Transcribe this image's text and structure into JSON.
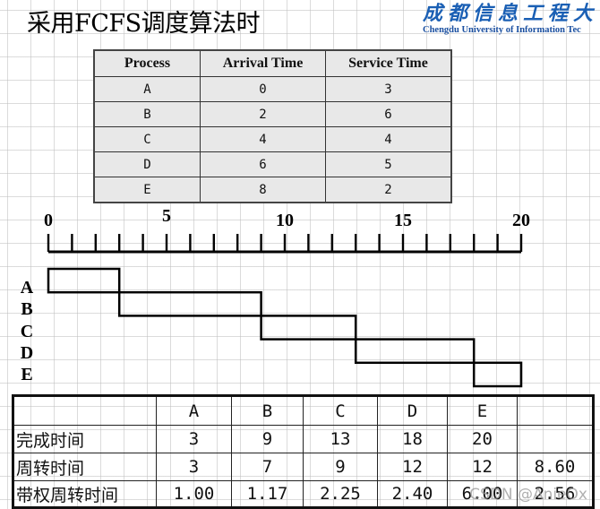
{
  "slide": {
    "title": "采用FCFS调度算法时",
    "logo": {
      "chinese_name": "成都信息工程大",
      "english_name": "Chengdu University of Information Tec",
      "color": "#1a5fb4"
    },
    "watermark": "CSDN @AnieOx"
  },
  "process_table": {
    "headers": [
      "Process",
      "Arrival Time",
      "Service Time"
    ],
    "rows": [
      [
        "A",
        "0",
        "3"
      ],
      [
        "B",
        "2",
        "6"
      ],
      [
        "C",
        "4",
        "4"
      ],
      [
        "D",
        "6",
        "5"
      ],
      [
        "E",
        "8",
        "2"
      ]
    ]
  },
  "chart_data": {
    "type": "gantt",
    "title": "",
    "xlabel": "",
    "ylabel": "",
    "xlim": [
      0,
      20
    ],
    "tick_step": 1,
    "tick_labels": [
      "0",
      "5",
      "10",
      "15",
      "20"
    ],
    "tick_label_values": [
      0,
      5,
      10,
      15,
      20
    ],
    "categories": [
      "A",
      "B",
      "C",
      "D",
      "E"
    ],
    "series": [
      {
        "name": "A",
        "start": 0,
        "end": 3
      },
      {
        "name": "B",
        "start": 3,
        "end": 9
      },
      {
        "name": "C",
        "start": 9,
        "end": 13
      },
      {
        "name": "D",
        "start": 13,
        "end": 18
      },
      {
        "name": "E",
        "start": 18,
        "end": 20
      }
    ],
    "grid": false
  },
  "result_table": {
    "header": [
      "",
      "A",
      "B",
      "C",
      "D",
      "E",
      ""
    ],
    "rows": [
      {
        "label": "完成时间",
        "values": [
          "3",
          "9",
          "13",
          "18",
          "20"
        ],
        "summary": ""
      },
      {
        "label": "周转时间",
        "values": [
          "3",
          "7",
          "9",
          "12",
          "12"
        ],
        "summary": "8.60"
      },
      {
        "label": "带权周转时间",
        "values": [
          "1.00",
          "1.17",
          "2.25",
          "2.40",
          "6.00"
        ],
        "summary": "2.56"
      }
    ]
  }
}
